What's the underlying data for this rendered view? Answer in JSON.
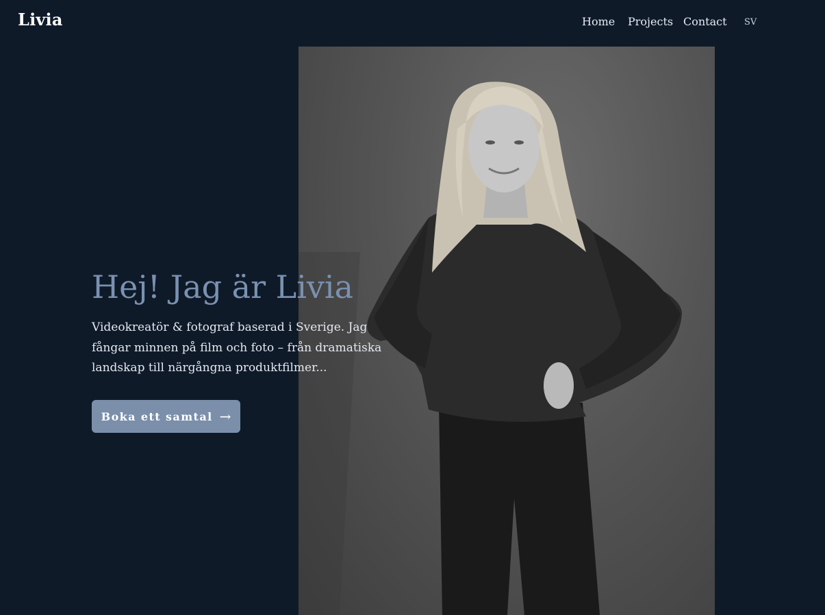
{
  "header": {
    "brand": "Livia",
    "nav": [
      {
        "label": "Home"
      },
      {
        "label": "Projects"
      },
      {
        "label": "Contact"
      }
    ],
    "language": "SV"
  },
  "hero": {
    "title": "Hej! Jag är Livia",
    "subtitle": "Videokreatör & fotograf baserad i Sverige. Jag fångar minnen på film och foto – från dramatiska landskap till närgångna produktfilmer...",
    "cta_label": "Boka ett samtal",
    "cta_icon": "arrow-right-icon"
  },
  "colors": {
    "background": "#0f1a29",
    "title": "#7a91b0",
    "cta": "#7b8fab"
  }
}
